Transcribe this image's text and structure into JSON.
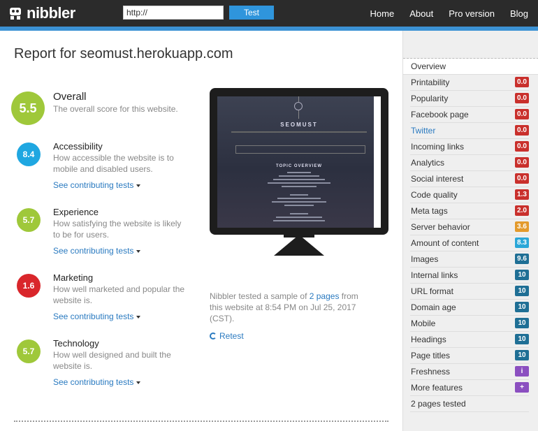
{
  "header": {
    "brand": "nibbler",
    "url_value": "http://",
    "test_label": "Test",
    "nav": [
      "Home",
      "About",
      "Pro version",
      "Blog"
    ]
  },
  "report": {
    "title": "Report for seomust.herokuapp.com",
    "overall": {
      "score": "5.5",
      "title": "Overall",
      "desc": "The overall score for this website.",
      "color": "#9fc83a"
    },
    "categories": [
      {
        "score": "8.4",
        "title": "Accessibility",
        "desc1": "How accessible the website is to",
        "desc2": "mobile and disabled users.",
        "link": "See contributing tests",
        "color": "#1fa7e1"
      },
      {
        "score": "5.7",
        "title": "Experience",
        "desc1": "How satisfying the website is likely",
        "desc2": "to be for users.",
        "link": "See contributing tests",
        "color": "#9fc83a"
      },
      {
        "score": "1.6",
        "title": "Marketing",
        "desc1": "How well marketed and popular the",
        "desc2": "website is.",
        "link": "See contributing tests",
        "color": "#d9262b"
      },
      {
        "score": "5.7",
        "title": "Technology",
        "desc1": "How well designed and built the",
        "desc2": "website is.",
        "link": "See contributing tests",
        "color": "#9fc83a"
      }
    ],
    "preview": {
      "site_title": "SEOMUST",
      "section_heading": "TOPIC OVERVIEW"
    },
    "sample": {
      "pre": "Nibbler tested a sample of ",
      "link": "2 pages",
      "post": " from this website at 8:54 PM on Jul 25, 2017 (CST)."
    },
    "retest": "Retest"
  },
  "sidebar": {
    "items": [
      {
        "label": "Overview",
        "badge": "",
        "color": ""
      },
      {
        "label": "Printability",
        "badge": "0.0",
        "color": "#c9302c"
      },
      {
        "label": "Popularity",
        "badge": "0.0",
        "color": "#c9302c"
      },
      {
        "label": "Facebook page",
        "badge": "0.0",
        "color": "#c9302c"
      },
      {
        "label": "Twitter",
        "badge": "0.0",
        "color": "#c9302c"
      },
      {
        "label": "Incoming links",
        "badge": "0.0",
        "color": "#c9302c"
      },
      {
        "label": "Analytics",
        "badge": "0.0",
        "color": "#c9302c"
      },
      {
        "label": "Social interest",
        "badge": "0.0",
        "color": "#c9302c"
      },
      {
        "label": "Code quality",
        "badge": "1.3",
        "color": "#c9302c"
      },
      {
        "label": "Meta tags",
        "badge": "2.0",
        "color": "#c9302c"
      },
      {
        "label": "Server behavior",
        "badge": "3.6",
        "color": "#e39a2c"
      },
      {
        "label": "Amount of content",
        "badge": "8.3",
        "color": "#2aa7d8"
      },
      {
        "label": "Images",
        "badge": "9.6",
        "color": "#1f6f95"
      },
      {
        "label": "Internal links",
        "badge": "10",
        "color": "#1f6f95"
      },
      {
        "label": "URL format",
        "badge": "10",
        "color": "#1f6f95"
      },
      {
        "label": "Domain age",
        "badge": "10",
        "color": "#1f6f95"
      },
      {
        "label": "Mobile",
        "badge": "10",
        "color": "#1f6f95"
      },
      {
        "label": "Headings",
        "badge": "10",
        "color": "#1f6f95"
      },
      {
        "label": "Page titles",
        "badge": "10",
        "color": "#1f6f95"
      },
      {
        "label": "Freshness",
        "badge": "i",
        "color": "#8b4fc0"
      },
      {
        "label": "More features",
        "badge": "+",
        "color": "#8b4fc0"
      },
      {
        "label": "2 pages tested",
        "badge": "",
        "color": ""
      }
    ]
  }
}
